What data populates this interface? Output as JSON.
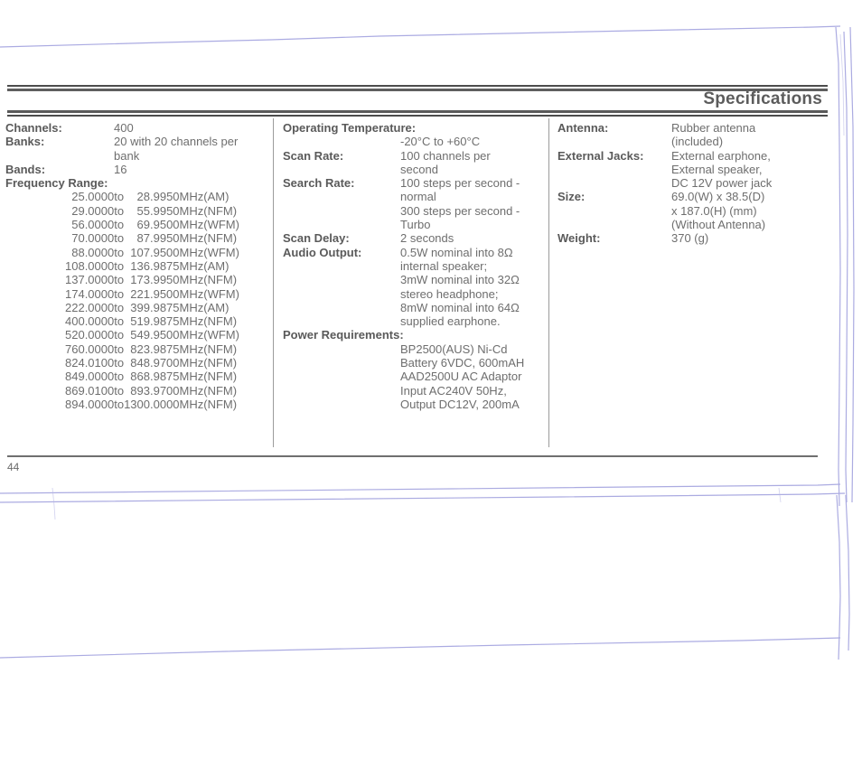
{
  "document": {
    "header_title": "Specifications",
    "page_number": "44",
    "text_color": "#6b6b6b",
    "rule_color": "#4c4c4c"
  },
  "columns": {
    "left": {
      "rows": [
        {
          "label": "Channels:",
          "values": [
            "400"
          ]
        },
        {
          "label": "Banks:",
          "values": [
            "20 with 20 channels per",
            "bank"
          ]
        },
        {
          "label": "Bands:",
          "values": [
            "16"
          ]
        }
      ],
      "frequency_range": {
        "label": "Frequency Range:",
        "rows": [
          {
            "low": "25.0000",
            "to": "to",
            "high": "28.9950",
            "unit": "MHz",
            "mode": "(AM)"
          },
          {
            "low": "29.0000",
            "to": "to",
            "high": "55.9950",
            "unit": "MHz",
            "mode": "(NFM)"
          },
          {
            "low": "56.0000",
            "to": "to",
            "high": "69.9500",
            "unit": "MHz",
            "mode": "(WFM)"
          },
          {
            "low": "70.0000",
            "to": "to",
            "high": "87.9950",
            "unit": "MHz",
            "mode": "(NFM)"
          },
          {
            "low": "88.0000",
            "to": "to",
            "high": "107.9500",
            "unit": "MHz",
            "mode": "(WFM)"
          },
          {
            "low": "108.0000",
            "to": "to",
            "high": "136.9875",
            "unit": "MHz",
            "mode": "(AM)"
          },
          {
            "low": "137.0000",
            "to": "to",
            "high": "173.9950",
            "unit": "MHz",
            "mode": "(NFM)"
          },
          {
            "low": "174.0000",
            "to": "to",
            "high": "221.9500",
            "unit": "MHz",
            "mode": "(WFM)"
          },
          {
            "low": "222.0000",
            "to": "to",
            "high": "399.9875",
            "unit": "MHz",
            "mode": "(AM)"
          },
          {
            "low": "400.0000",
            "to": "to",
            "high": "519.9875",
            "unit": "MHz",
            "mode": "(NFM)"
          },
          {
            "low": "520.0000",
            "to": "to",
            "high": "549.9500",
            "unit": "MHz",
            "mode": "(WFM)"
          },
          {
            "low": "760.0000",
            "to": "to",
            "high": "823.9875",
            "unit": "MHz",
            "mode": "(NFM)"
          },
          {
            "low": "824.0100",
            "to": "to",
            "high": "848.9700",
            "unit": "MHz",
            "mode": "(NFM)"
          },
          {
            "low": "849.0000",
            "to": "to",
            "high": "868.9875",
            "unit": "MHz",
            "mode": "(NFM)"
          },
          {
            "low": "869.0100",
            "to": "to",
            "high": "893.9700",
            "unit": "MHz",
            "mode": "(NFM)"
          },
          {
            "low": "894.0000",
            "to": "to",
            "high": "1300.0000",
            "unit": "MHz",
            "mode": "(NFM)"
          }
        ]
      }
    },
    "middle": {
      "operating_temperature": {
        "label": "Operating Temperature:",
        "values": [
          "-20°C to +60°C"
        ]
      },
      "rows": [
        {
          "label": "Scan Rate:",
          "values": [
            "100 channels per",
            "second"
          ]
        },
        {
          "label": "Search Rate:",
          "values": [
            "100 steps per second -",
            "normal",
            "300 steps per second -",
            "Turbo"
          ]
        },
        {
          "label": "Scan Delay:",
          "values": [
            "2 seconds"
          ]
        },
        {
          "label": "Audio Output:",
          "values": [
            "0.5W nominal into 8Ω",
            "internal speaker;",
            "3mW nominal into 32Ω",
            "stereo headphone;",
            "8mW nominal into 64Ω",
            "supplied earphone."
          ]
        }
      ],
      "power_requirements": {
        "label": "Power Requirements:",
        "values": [
          "BP2500(AUS) Ni-Cd",
          "Battery 6VDC, 600mAH",
          "AAD2500U AC Adaptor",
          "Input AC240V 50Hz,",
          "Output DC12V, 200mA"
        ]
      }
    },
    "right": {
      "rows": [
        {
          "label": "Antenna:",
          "values": [
            "Rubber antenna",
            "(included)"
          ]
        },
        {
          "label": "External Jacks:",
          "values": [
            "External earphone,",
            "External speaker,",
            "DC 12V power jack"
          ]
        },
        {
          "label": "Size:",
          "values": [
            "69.0(W) x 38.5(D)",
            "x 187.0(H) (mm)",
            "(Without Antenna)"
          ]
        },
        {
          "label": "Weight:",
          "values": [
            "370 (g)"
          ]
        }
      ]
    }
  }
}
